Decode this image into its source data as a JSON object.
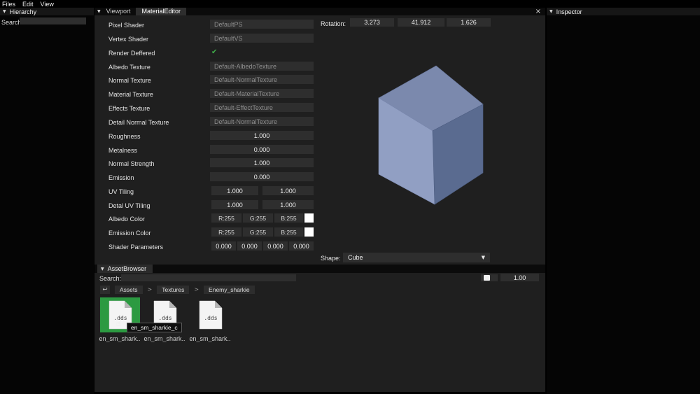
{
  "icons": {
    "collapse": "▼",
    "close": "×",
    "check": "✔",
    "dropdown": "▼",
    "chevron": ">",
    "back": "↩",
    "hand": "☝"
  },
  "colors": {
    "check_green": "#3fae49",
    "selection_green": "#2c9a41",
    "cube_top": "#7b89ad",
    "cube_left": "#919fc3",
    "cube_right": "#5a6b90",
    "swatch_white": "#ffffff"
  },
  "menu": {
    "items": [
      "Files",
      "Edit",
      "View"
    ]
  },
  "hierarchy_panel": {
    "title": "Hierarchy",
    "search_label": "Search:",
    "search_value": ""
  },
  "inspector_panel": {
    "title": "Inspector"
  },
  "material_editor": {
    "tab_viewport": "Viewport",
    "tab_material_editor": "MaterialEditor",
    "rows": {
      "pixel_shader": {
        "label": "Pixel Shader",
        "value": "DefaultPS"
      },
      "vertex_shader": {
        "label": "Vertex Shader",
        "value": "DefaultVS"
      },
      "render_deffered": {
        "label": "Render Deffered"
      },
      "albedo_texture": {
        "label": "Albedo Texture",
        "value": "Default-AlbedoTexture"
      },
      "normal_texture": {
        "label": "Normal Texture",
        "value": "Default-NormalTexture"
      },
      "material_texture": {
        "label": "Material Texture",
        "value": "Default-MaterialTexture"
      },
      "effects_texture": {
        "label": "Effects Texture",
        "value": "Default-EffectTexture"
      },
      "detail_normal_texture": {
        "label": "Detail Normal Texture",
        "value": "Default-NormalTexture"
      },
      "roughness": {
        "label": "Roughness",
        "value": "1.000"
      },
      "metalness": {
        "label": "Metalness",
        "value": "0.000"
      },
      "normal_strength": {
        "label": "Normal Strength",
        "value": "1.000"
      },
      "emission": {
        "label": "Emission",
        "value": "0.000"
      },
      "uv_tiling": {
        "label": "UV Tiling",
        "u": "1.000",
        "v": "1.000"
      },
      "detail_uv_tiling": {
        "label": "Detal UV Tiling",
        "u": "1.000",
        "v": "1.000"
      },
      "albedo_color": {
        "label": "Albedo Color",
        "r": "R:255",
        "g": "G:255",
        "b": "B:255"
      },
      "emission_color": {
        "label": "Emission Color",
        "r": "R:255",
        "g": "G:255",
        "b": "B:255"
      },
      "shader_parameters": {
        "label": "Shader Parameters",
        "p0": "0.000",
        "p1": "0.000",
        "p2": "0.000",
        "p3": "0.000"
      }
    },
    "rotation": {
      "label": "Rotation:",
      "x": "3.273",
      "y": "41.912",
      "z": "1.626"
    },
    "shape": {
      "label": "Shape:",
      "value": "Cube"
    }
  },
  "asset_browser": {
    "title": "AssetBrowser",
    "search_label": "Search:",
    "search_value": "",
    "breadcrumb": {
      "root": "Assets",
      "sub": "Textures",
      "folder": "Enemy_sharkie"
    },
    "scale_value": "1.00",
    "files": [
      {
        "label": "en_sm_shark..",
        "ext": ".dds"
      },
      {
        "label": "en_sm_shark..",
        "ext": ".dds"
      },
      {
        "label": "en_sm_shark..",
        "ext": ".dds"
      }
    ],
    "drag_tooltip": "en_sm_sharkie_c"
  }
}
